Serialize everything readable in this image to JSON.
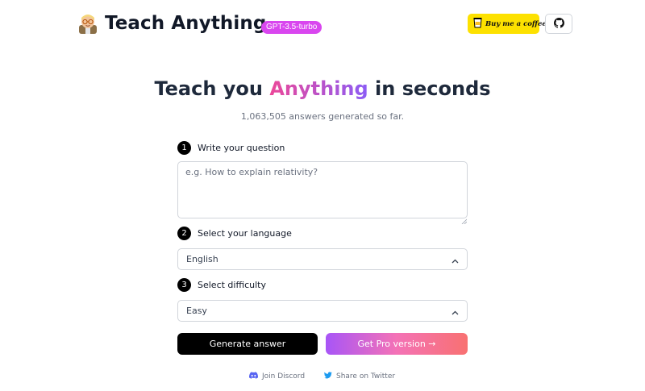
{
  "header": {
    "brand": "Teach Anything",
    "model_badge": "GPT-3.5-turbo",
    "coffee_label": "Buy me a coffee"
  },
  "hero": {
    "title_before": "Teach you ",
    "title_highlight": "Anything",
    "title_after": " in seconds",
    "counter": "1,063,505 answers generated so far."
  },
  "form": {
    "steps": [
      {
        "num": "1",
        "label": "Write your question"
      },
      {
        "num": "2",
        "label": "Select your language"
      },
      {
        "num": "3",
        "label": "Select difficulty"
      }
    ],
    "question_placeholder": "e.g. How to explain relativity?",
    "language_value": "English",
    "difficulty_value": "Easy",
    "generate_label": "Generate answer",
    "pro_label": "Get Pro version →"
  },
  "footer": {
    "discord_label": "Join Discord",
    "twitter_label": "Share on Twitter"
  },
  "colors": {
    "badge": "#d946ef",
    "coffee": "#fde100",
    "discord": "#5865f2",
    "twitter": "#1d9bf0"
  }
}
